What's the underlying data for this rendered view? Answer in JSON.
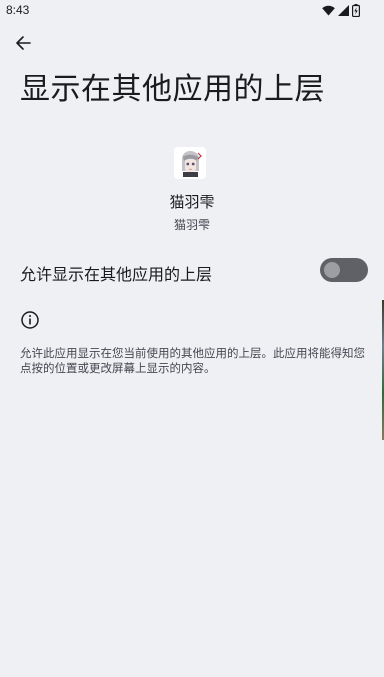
{
  "status_bar": {
    "time": "8:43",
    "icons": [
      "wifi-icon",
      "signal-icon",
      "battery-icon"
    ]
  },
  "header": {
    "back_icon": "arrow-back-icon",
    "title": "显示在其他应用的上层"
  },
  "app": {
    "icon": "app-avatar-icon",
    "name": "猫羽雫",
    "subtitle": "猫羽雫"
  },
  "permission": {
    "label": "允许显示在其他应用的上层",
    "enabled": false
  },
  "info": {
    "icon": "info-icon",
    "text": "允许此应用显示在您当前使用的其他应用的上层。此应用将能得知您点按的位置或更改屏幕上显示的内容。"
  },
  "colors": {
    "background": "#eff0f4",
    "toggle_track_off": "#5f6166",
    "toggle_thumb_off": "#9c9ea4"
  }
}
